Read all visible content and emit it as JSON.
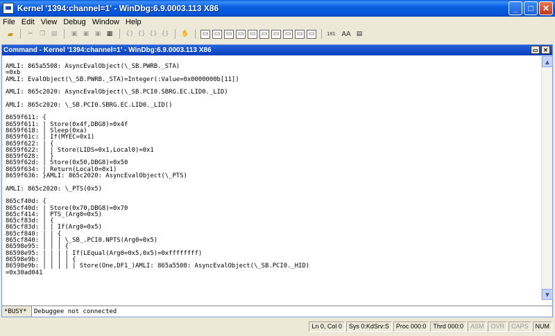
{
  "window": {
    "title": "Kernel '1394:channel=1' - WinDbg:6.9.0003.113 X86",
    "minimize": "_",
    "maximize": "□",
    "close": "✕"
  },
  "menu": [
    "File",
    "Edit",
    "View",
    "Debug",
    "Window",
    "Help"
  ],
  "command_window": {
    "title": "Command - Kernel '1394:channel=1' - WinDbg:6.9.0003.113 X86",
    "restore": "▭",
    "close": "✕",
    "lines": [
      "AMLI: 865a5508: AsyncEvalObject(\\_SB.PWRB._STA)",
      "=0xb",
      "AMLI: EvalObject(\\_SB.PWRB._STA)=Integer(:Value=0x0000000b[11])",
      "",
      "AMLI: 865c2020: AsyncEvalObject(\\_SB.PCI0.SBRG.EC.LID0._LID)",
      "",
      "AMLI: 865c2020: \\_SB.PCI0.SBRG.EC.LID0._LID()",
      "",
      "8659f611: {",
      "8659f611: | Store(0x4f,DBG8)=0x4f",
      "8659f618: | Sleep(0xa)",
      "8659f61c: | If(MYEC=0x1)",
      "8659f622: | {",
      "8659f622: | | Store(LIDS=0x1,Local0)=0x1",
      "8659f628: | }",
      "8659f62d: | Store(0x50,DBG8)=0x50",
      "8659f634: | Return(Local0=0x1)",
      "8659f636: }AMLI: 865c2020: AsyncEvalObject(\\_PTS)",
      "",
      "AMLI: 865c2020: \\_PTS(0x5)",
      "",
      "865cf40d: {",
      "865cf40d: | Store(0x70,DBG8)=0x70",
      "865cf414: | PTS_(Arg0=0x5)",
      "865cf83d: | {",
      "865cf83d: | | If(Arg0=0x5)",
      "865cf840: | | {",
      "865cf840: | | | \\_SB_.PCI0.NPTS(Arg0=0x5)",
      "86598e95: | | | {",
      "86598e95: | | | | If(LEqual(Arg0=0x5,0x5)=0xffffffff)",
      "86598e9b: | | | | {",
      "86598e9b: | | | | | Store(One,DF1_)AMLI: 865a5508: AsyncEvalObject(\\_SB.PCI0._HID)",
      "=0x30ad041"
    ]
  },
  "command_prompt": "*BUSY*",
  "command_input": "Debuggee not connected",
  "status": [
    "Ln 0, Col 0",
    "Sys 0:KdSrv:S",
    "Proc 000:0",
    "Thrd 000:0",
    "ASM",
    "OVR",
    "CAPS",
    "NUM"
  ],
  "status_dim": [
    false,
    false,
    false,
    false,
    true,
    true,
    true,
    false
  ],
  "toolbar_glyphs": {
    "open": "📂",
    "cut": "✂",
    "hand": "✋",
    "font": "AA",
    "bin": "101"
  }
}
